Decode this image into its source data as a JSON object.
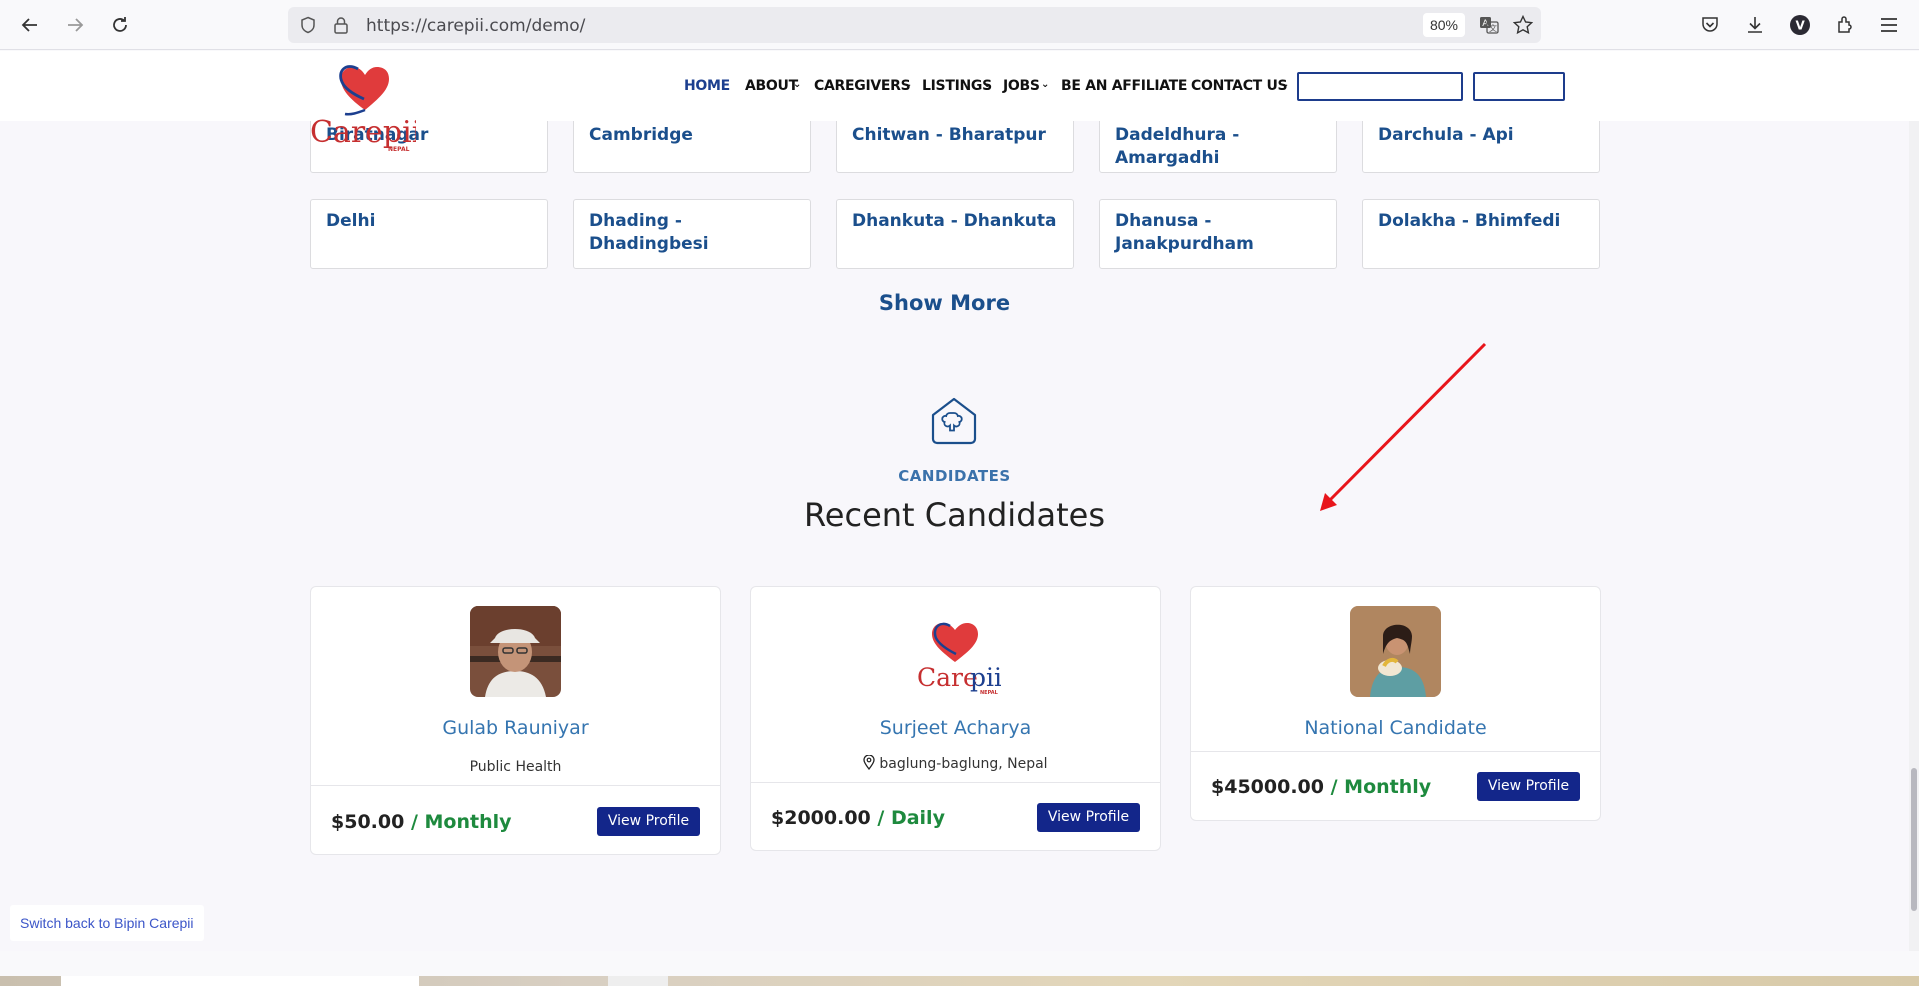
{
  "browser": {
    "url": "https://carepii.com/demo/",
    "zoom": "80%"
  },
  "site": {
    "logo_text": "Carepii",
    "logo_sub": "NEPAL",
    "nav": [
      {
        "label": "HOME"
      },
      {
        "label": "ABOUT"
      },
      {
        "label": "CAREGIVERS"
      },
      {
        "label": "LISTINGS"
      },
      {
        "label": "JOBS"
      },
      {
        "label": "BE AN AFFILIATE"
      },
      {
        "label": "CONTACT US"
      }
    ]
  },
  "cities": {
    "row1": [
      "Biratnagar",
      "Cambridge",
      "Chitwan - Bharatpur",
      "Dadeldhura - Amargadhi",
      "Darchula - Api"
    ],
    "row2": [
      "Delhi",
      "Dhading - Dhadingbesi",
      "Dhankuta - Dhankuta",
      "Dhanusa - Janakpurdham",
      "Dolakha - Bhimfedi"
    ],
    "show_more": "Show More"
  },
  "candidates_section": {
    "tag": "CANDIDATES",
    "title": "Recent Candidates",
    "cards": [
      {
        "name": "Gulab Rauniyar",
        "sub": "Public Health",
        "price": "$50.00",
        "period": "/ Monthly",
        "button": "View Profile"
      },
      {
        "name": "Surjeet Acharya",
        "sub": "baglung-baglung, Nepal",
        "price": "$2000.00",
        "period": "/ Daily",
        "button": "View Profile"
      },
      {
        "name": "National Candidate",
        "sub": "",
        "price": "$45000.00",
        "period": "/ Monthly",
        "button": "View Profile"
      }
    ]
  },
  "switch_back": "Switch back to Bipin Carepii",
  "colors": {
    "brand_blue": "#1b4f8c",
    "button_blue": "#13268a",
    "period_green": "#1e8a3e",
    "annotation_red": "#e8151b"
  }
}
